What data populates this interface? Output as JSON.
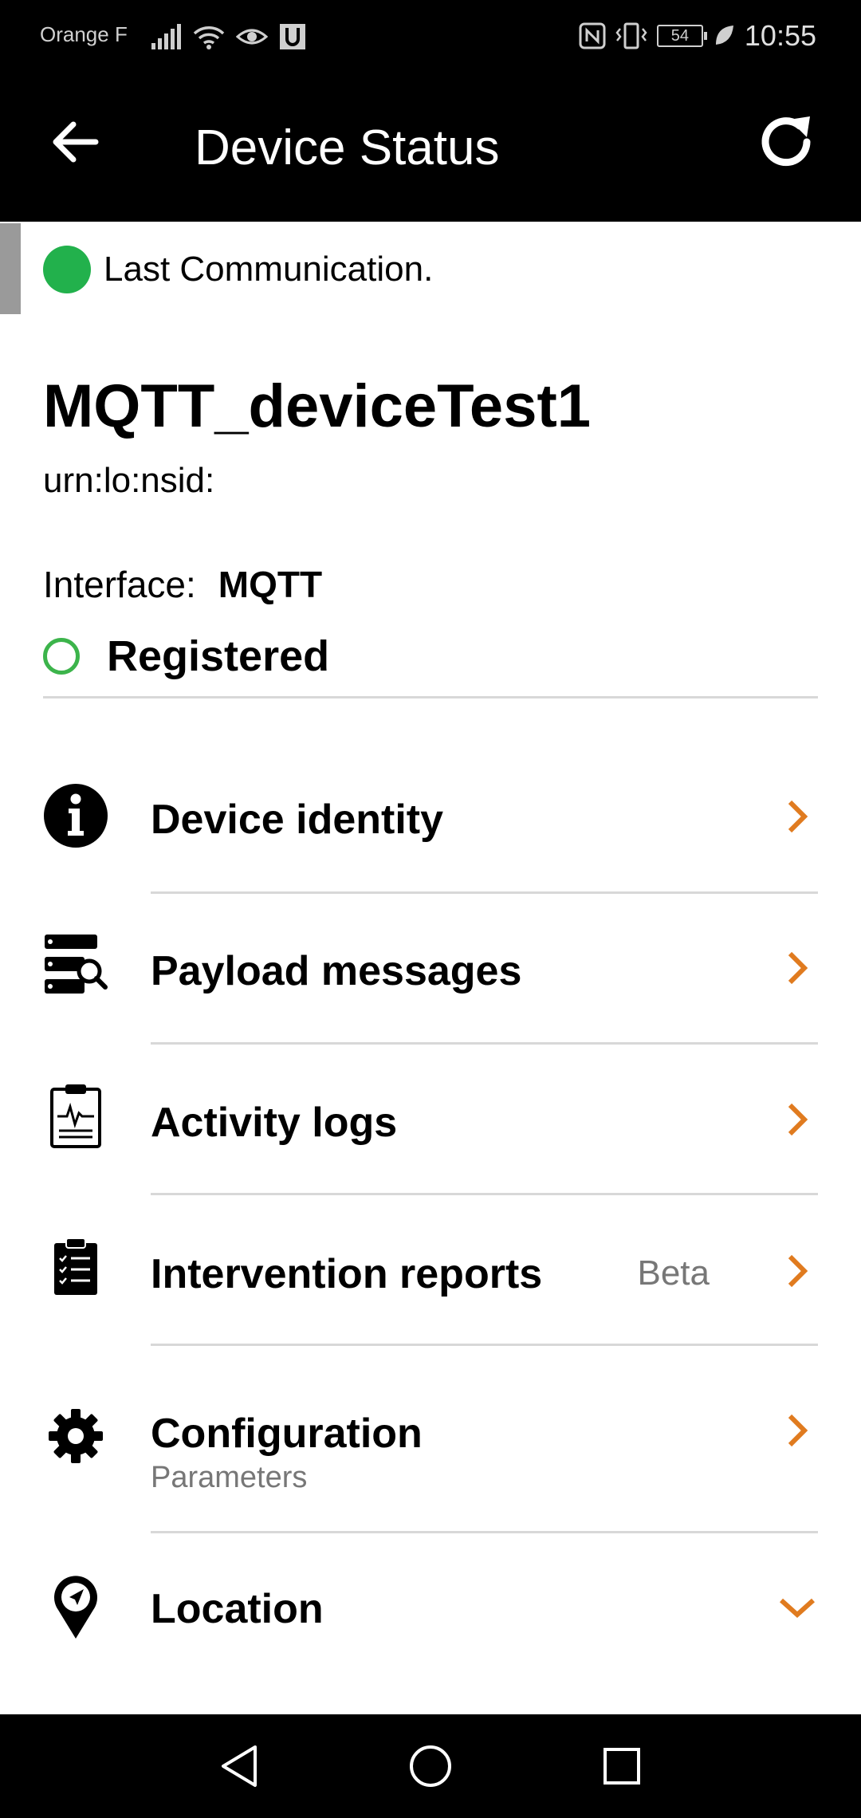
{
  "status_bar": {
    "carrier": "Orange F",
    "battery": "54",
    "time": "10:55"
  },
  "app_bar": {
    "title": "Device Status",
    "back_icon": "arrow-left-icon",
    "refresh_icon": "refresh-icon"
  },
  "communication": {
    "label": "Last Communication.",
    "indicator_color": "#22b14c"
  },
  "device": {
    "name": "MQTT_deviceTest1",
    "urn": "urn:lo:nsid:",
    "interface_label": "Interface:",
    "interface_value": "MQTT",
    "status": "Registered",
    "status_color": "#3cb44b"
  },
  "menu": {
    "accent_color": "#e07b1f",
    "items": [
      {
        "label": "Device identity",
        "icon": "info-icon"
      },
      {
        "label": "Payload messages",
        "icon": "server-search-icon"
      },
      {
        "label": "Activity logs",
        "icon": "clipboard-pulse-icon"
      },
      {
        "label": "Intervention reports",
        "icon": "clipboard-checklist-icon",
        "badge": "Beta"
      },
      {
        "label": "Configuration",
        "icon": "gear-icon",
        "sublabel": "Parameters"
      },
      {
        "label": "Location",
        "icon": "location-pin-icon"
      }
    ]
  },
  "nav_bar": {
    "back": "triangle-back-icon",
    "home": "circle-home-icon",
    "recents": "square-recents-icon"
  }
}
